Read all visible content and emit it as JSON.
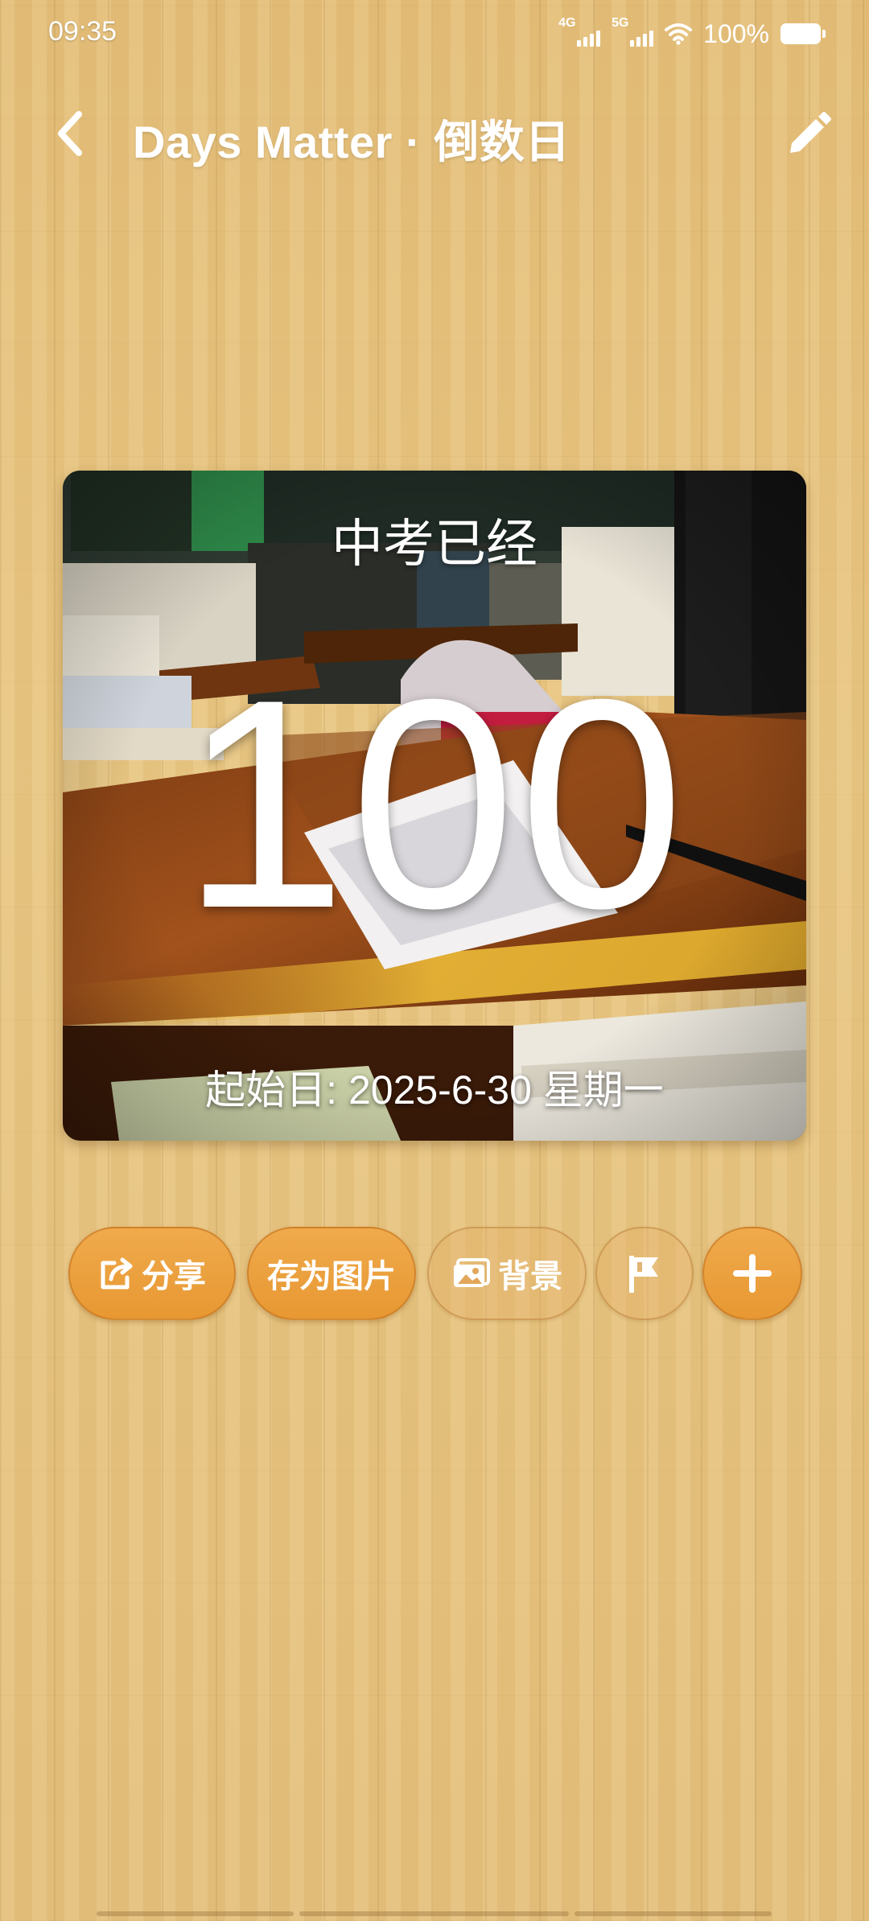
{
  "status_bar": {
    "time": "09:35",
    "network_1": "4G",
    "network_2": "5G",
    "battery": "100%"
  },
  "header": {
    "title": "Days Matter · 倒数日"
  },
  "card": {
    "label": "中考已经",
    "days": "100",
    "start_date": "起始日: 2025-6-30 星期一"
  },
  "actions": {
    "share_label": "分享",
    "save_image_label": "存为图片",
    "background_label": "背景"
  },
  "icons": {
    "back": "chevron-left-icon",
    "edit": "pencil-icon",
    "share": "share-icon",
    "background": "image-icon",
    "flag": "flag-icon",
    "add": "plus-icon",
    "wifi": "wifi-icon",
    "battery": "battery-icon"
  },
  "colors": {
    "accent": "#E79832",
    "wood": "#E7C27E"
  }
}
